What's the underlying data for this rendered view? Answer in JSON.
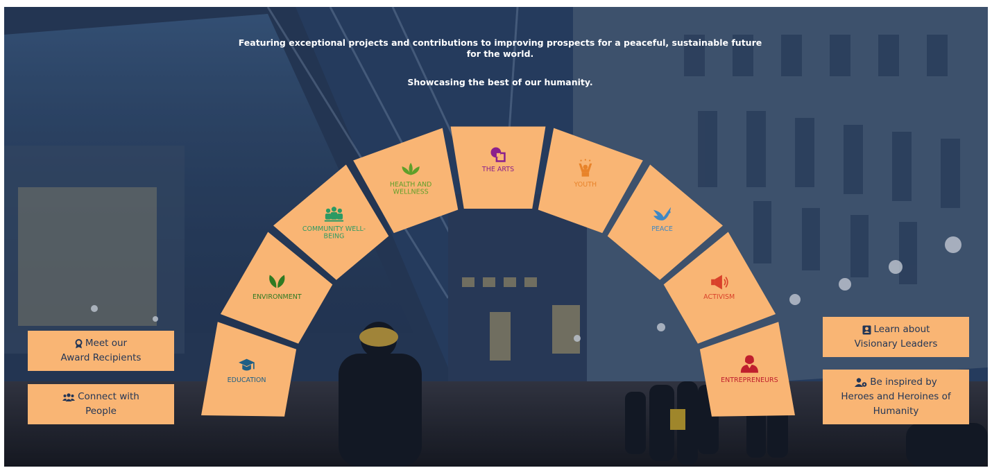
{
  "hero": {
    "tagline": "Featuring exceptional projects and contributions to improving prospects for a peaceful, sustainable future for the world.",
    "subtagline": "Showcasing the best of our humanity."
  },
  "arch": {
    "segment_fill": "#f9b574",
    "categories": [
      {
        "key": "education",
        "lines": [
          "EDUCATION"
        ],
        "icon": "graduation-cap-icon",
        "color": "#1e5f86"
      },
      {
        "key": "environment",
        "lines": [
          "ENVIRONMENT"
        ],
        "icon": "leaves-icon",
        "color": "#2f7a22"
      },
      {
        "key": "community",
        "lines": [
          "COMMUNITY WELL-",
          "BEING"
        ],
        "icon": "people-group-icon",
        "color": "#2c9a63"
      },
      {
        "key": "health",
        "lines": [
          "HEALTH AND",
          "WELLNESS"
        ],
        "icon": "lotus-icon",
        "color": "#5f9f2a"
      },
      {
        "key": "arts",
        "lines": [
          "THE ARTS"
        ],
        "icon": "shapes-icon",
        "color": "#8b1f8c"
      },
      {
        "key": "youth",
        "lines": [
          "YOUTH"
        ],
        "icon": "child-icon",
        "color": "#e8832a"
      },
      {
        "key": "peace",
        "lines": [
          "PEACE"
        ],
        "icon": "dove-icon",
        "color": "#3f88c4"
      },
      {
        "key": "activism",
        "lines": [
          "ACTIVISM"
        ],
        "icon": "megaphone-icon",
        "color": "#d9412a"
      },
      {
        "key": "entrepreneurs",
        "lines": [
          "ENTREPRENEURS"
        ],
        "icon": "businesswoman-icon",
        "color": "#bf1e2d"
      }
    ]
  },
  "buttons": {
    "award": {
      "line1": "Meet our",
      "line2": "Award Recipients",
      "icon": "award-icon"
    },
    "people": {
      "line1": "Connect with",
      "line2": "People",
      "icon": "users-icon"
    },
    "visionary": {
      "line1": "Learn about",
      "line2": "Visionary Leaders",
      "icon": "portrait-icon"
    },
    "heroes": {
      "line1": "Be inspired by",
      "line2": "Heroes and Heroines of",
      "line3": "Humanity",
      "icon": "user-tie-icon"
    }
  }
}
